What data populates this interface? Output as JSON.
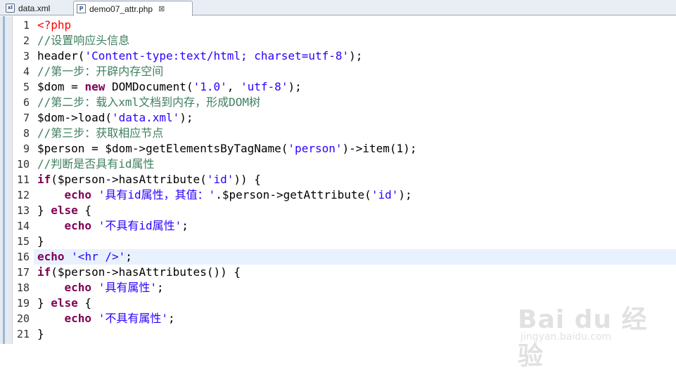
{
  "tabs": [
    {
      "label": "data.xml",
      "icon": "xml-file-icon",
      "active": false
    },
    {
      "label": "demo07_attr.php",
      "icon": "php-file-icon",
      "active": true,
      "close": "⊠"
    }
  ],
  "editor": {
    "current_line": 16,
    "lines": [
      {
        "n": "1",
        "segs": [
          [
            "tag",
            "<?php"
          ]
        ]
      },
      {
        "n": "2",
        "segs": [
          [
            "cm",
            "//设置响应头信息"
          ]
        ]
      },
      {
        "n": "3",
        "segs": [
          [
            "",
            "header("
          ],
          [
            "str",
            "'Content-type:text/html; charset=utf-8'"
          ],
          [
            "",
            ");"
          ]
        ]
      },
      {
        "n": "4",
        "segs": [
          [
            "cm",
            "//第一步：开辟内存空间"
          ]
        ]
      },
      {
        "n": "5",
        "segs": [
          [
            "",
            "$dom = "
          ],
          [
            "kw",
            "new"
          ],
          [
            "",
            " DOMDocument("
          ],
          [
            "str",
            "'1.0'"
          ],
          [
            "",
            ", "
          ],
          [
            "str",
            "'utf-8'"
          ],
          [
            "",
            ");"
          ]
        ]
      },
      {
        "n": "6",
        "segs": [
          [
            "cm",
            "//第二步：载入xml文档到内存，形成DOM树"
          ]
        ]
      },
      {
        "n": "7",
        "segs": [
          [
            "",
            "$dom->load("
          ],
          [
            "str",
            "'data.xml'"
          ],
          [
            "",
            ");"
          ]
        ]
      },
      {
        "n": "8",
        "segs": [
          [
            "cm",
            "//第三步：获取相应节点"
          ]
        ]
      },
      {
        "n": "9",
        "segs": [
          [
            "",
            "$person = $dom->getElementsByTagName("
          ],
          [
            "str",
            "'person'"
          ],
          [
            "",
            ")->item(1);"
          ]
        ]
      },
      {
        "n": "10",
        "segs": [
          [
            "cm",
            "//判断是否具有id属性"
          ]
        ]
      },
      {
        "n": "11",
        "segs": [
          [
            "kw",
            "if"
          ],
          [
            "",
            "($person->hasAttribute("
          ],
          [
            "str",
            "'id'"
          ],
          [
            "",
            ")) {"
          ]
        ]
      },
      {
        "n": "12",
        "segs": [
          [
            "",
            "    "
          ],
          [
            "kw",
            "echo"
          ],
          [
            "",
            " "
          ],
          [
            "str",
            "'具有id属性，其值：'"
          ],
          [
            "",
            ".$person->getAttribute("
          ],
          [
            "str",
            "'id'"
          ],
          [
            "",
            ");"
          ]
        ]
      },
      {
        "n": "13",
        "segs": [
          [
            "",
            "} "
          ],
          [
            "kw",
            "else"
          ],
          [
            "",
            " {"
          ]
        ]
      },
      {
        "n": "14",
        "segs": [
          [
            "",
            "    "
          ],
          [
            "kw",
            "echo"
          ],
          [
            "",
            " "
          ],
          [
            "str",
            "'不具有id属性'"
          ],
          [
            "",
            ";"
          ]
        ]
      },
      {
        "n": "15",
        "segs": [
          [
            "",
            "}"
          ]
        ]
      },
      {
        "n": "16",
        "segs": [
          [
            "kw",
            "echo"
          ],
          [
            "",
            " "
          ],
          [
            "str",
            "'<hr />'"
          ],
          [
            "",
            ";"
          ]
        ]
      },
      {
        "n": "17",
        "segs": [
          [
            "kw",
            "if"
          ],
          [
            "",
            "($person->hasAttributes()) {"
          ]
        ]
      },
      {
        "n": "18",
        "segs": [
          [
            "",
            "    "
          ],
          [
            "kw",
            "echo"
          ],
          [
            "",
            " "
          ],
          [
            "str",
            "'具有属性'"
          ],
          [
            "",
            ";"
          ]
        ]
      },
      {
        "n": "19",
        "segs": [
          [
            "",
            "} "
          ],
          [
            "kw",
            "else"
          ],
          [
            "",
            " {"
          ]
        ]
      },
      {
        "n": "20",
        "segs": [
          [
            "",
            "    "
          ],
          [
            "kw",
            "echo"
          ],
          [
            "",
            " "
          ],
          [
            "str",
            "'不具有属性'"
          ],
          [
            "",
            ";"
          ]
        ]
      },
      {
        "n": "21",
        "segs": [
          [
            "",
            "}"
          ]
        ]
      }
    ]
  },
  "watermark": {
    "main": "Bai du 经验",
    "sub": "jingyan.baidu.com"
  }
}
